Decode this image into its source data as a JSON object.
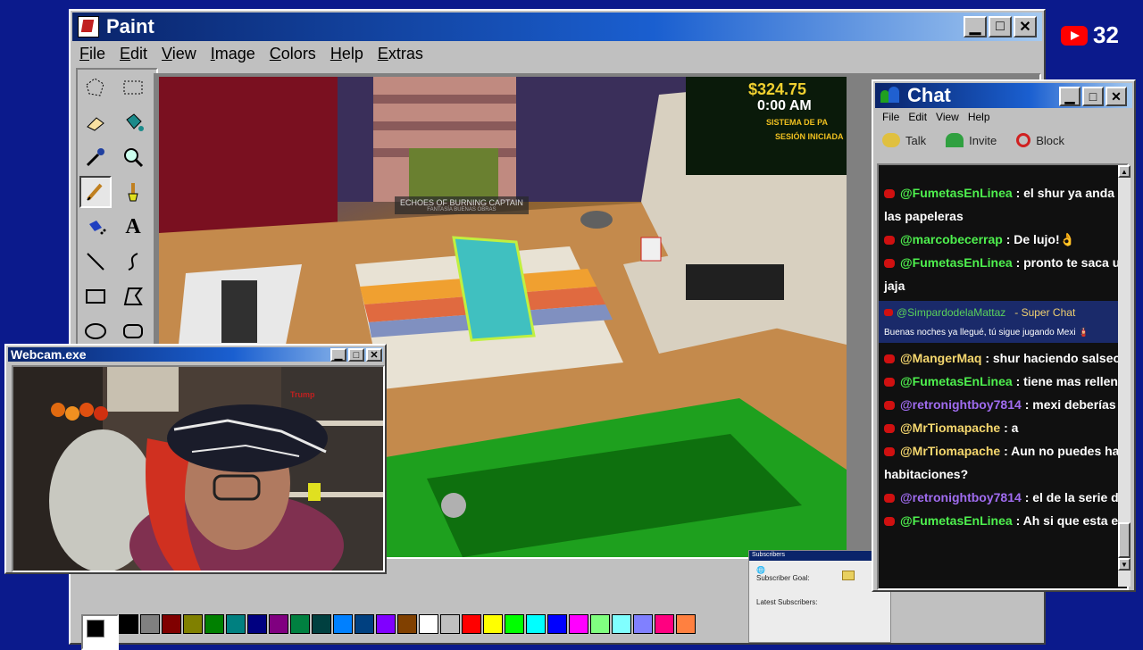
{
  "paint": {
    "title": "Paint",
    "menu": [
      "File",
      "Edit",
      "View",
      "Image",
      "Colors",
      "Help",
      "Extras"
    ],
    "tools": [
      "free-select",
      "rect-select",
      "eraser",
      "fill",
      "color-picker",
      "magnifier",
      "pencil",
      "brush",
      "airbrush",
      "text",
      "line",
      "curve",
      "rectangle",
      "polygon",
      "ellipse",
      "rounded-rect"
    ],
    "palette": [
      "#000000",
      "#808080",
      "#800000",
      "#808000",
      "#008000",
      "#008080",
      "#000080",
      "#800080",
      "#008040",
      "#004040",
      "#0080ff",
      "#004080",
      "#8000ff",
      "#804000",
      "#ffffff",
      "#c0c0c0",
      "#ff0000",
      "#ffff00",
      "#00ff00",
      "#00ffff",
      "#0000ff",
      "#ff00ff",
      "#80ff80",
      "#80ffff",
      "#8080ff",
      "#ff0080",
      "#ff8040"
    ]
  },
  "game": {
    "money": "$324.75",
    "time": "0:00 AM",
    "screen_line1": "SISTEMA DE PA",
    "screen_line2": "SESIÓN INICIADA",
    "tape_title": "ECHOES OF BURNING CAPTAIN",
    "tape_sub": "FANTASÍA BUENAS OBRAS"
  },
  "webcam": {
    "title": "Webcam.exe",
    "shelf_label": "Trump"
  },
  "chat": {
    "title": "Chat",
    "menu": [
      "File",
      "Edit",
      "View",
      "Help"
    ],
    "actions": [
      {
        "icon": "talk-icon",
        "label": "Talk"
      },
      {
        "icon": "invite-icon",
        "label": "Invite"
      },
      {
        "icon": "block-icon",
        "label": "Block"
      }
    ],
    "messages": [
      {
        "user": "@FumetasEnLinea",
        "text": ": el shur ya anda por los l",
        "cont": "las papeleras",
        "color": "green"
      },
      {
        "user": "@marcobecerrap",
        "text": ": De lujo!👌",
        "color": "green"
      },
      {
        "user": "@FumetasEnLinea",
        "text": ": pronto te saca una notic",
        "cont": "jaja",
        "color": "green"
      },
      {
        "user": "@MangerMaq",
        "text": ": shur haciendo salseo de stre",
        "color": "yellow"
      },
      {
        "user": "@FumetasEnLinea",
        "text": ": tiene mas relleno que n",
        "color": "green"
      },
      {
        "user": "@retronightboy7814",
        "text": ": mexi deberías reacci",
        "color": "purple"
      },
      {
        "user": "@MrTiomapache",
        "text": ": a",
        "color": "yellow"
      },
      {
        "user": "@MrTiomapache",
        "text": ": Aun no puedes hacer ma",
        "cont": "habitaciones?",
        "color": "yellow"
      },
      {
        "user": "@retronightboy7814",
        "text": ": el de la serie de peru",
        "color": "purple"
      },
      {
        "user": "@FumetasEnLinea",
        "text": ": Ah si que esta en una se",
        "color": "green"
      }
    ],
    "superchat": {
      "user": "@SimpardodelaMattaz",
      "tag": "- Super Chat",
      "message": "Buenas noches ya llegué, tú sigue jugando Mexi 🧯"
    }
  },
  "subscribers": {
    "title": "Subscribers",
    "goal_label": "Subscriber Goal:",
    "latest_label": "Latest Subscribers:"
  },
  "youtube": {
    "count": "32"
  },
  "colors": {
    "desktop": "#0b1a8c",
    "chat_green": "#4ef04e",
    "chat_purple": "#a06cf0",
    "chat_yellow": "#f5d76e"
  }
}
